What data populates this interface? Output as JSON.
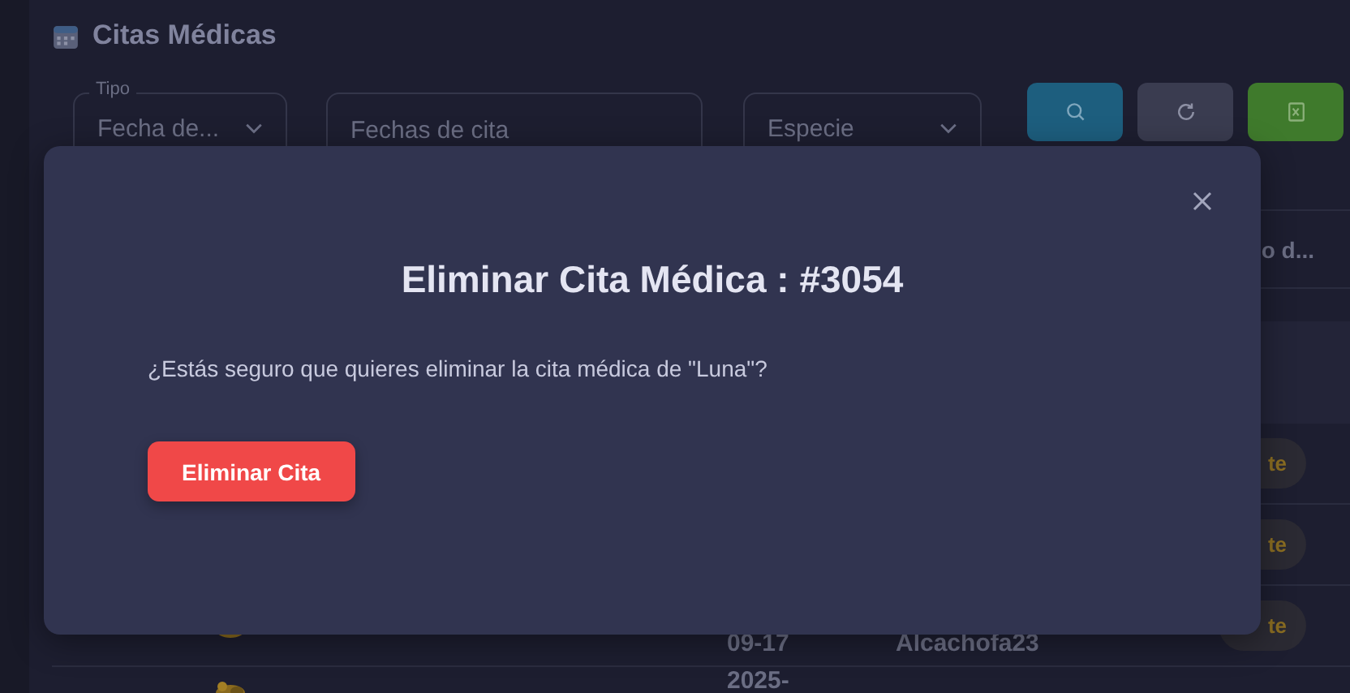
{
  "page": {
    "title": "Citas Médicas"
  },
  "filters": {
    "tipo": {
      "label": "Tipo",
      "value": "Fecha de..."
    },
    "fechas": {
      "placeholder": "Fechas de cita"
    },
    "especie": {
      "placeholder": "Especie"
    }
  },
  "actions": [
    {
      "kind": "search"
    },
    {
      "kind": "refresh"
    },
    {
      "kind": "excel"
    }
  ],
  "table": {
    "columns": [
      {
        "label": "o d..."
      }
    ],
    "rows": [
      {
        "kind": "band"
      },
      {
        "badge": "te"
      },
      {
        "badge": "te"
      },
      {
        "date": "09-17",
        "owner": "Alcachofa23",
        "badge": "te"
      },
      {
        "date": "2025-"
      }
    ]
  },
  "dialog": {
    "title": "Eliminar Cita Médica : #3054",
    "message": "¿Estás seguro que quieres eliminar la cita médica de \"Luna\"?",
    "confirm": "Eliminar Cita"
  }
}
